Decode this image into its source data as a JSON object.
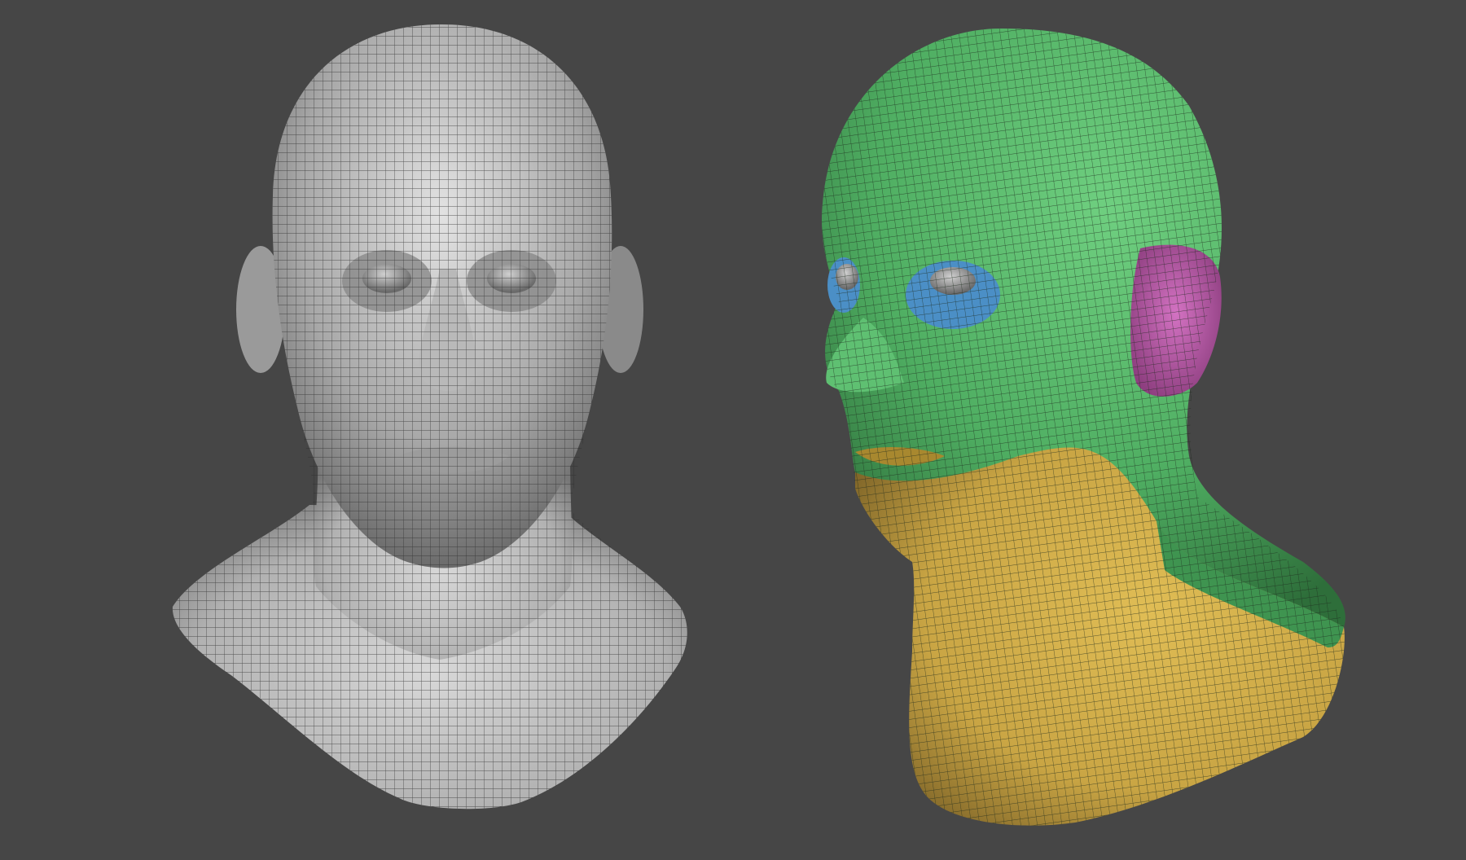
{
  "viewport": {
    "background_color": "#464646"
  },
  "models": [
    {
      "name": "front-view-head",
      "view": "front",
      "material": "clay-gray",
      "polygroups": [
        {
          "region": "head",
          "color": "#bcbcbc"
        }
      ]
    },
    {
      "name": "three-quarter-view-head",
      "view": "three-quarter",
      "material": "polygroup-colored",
      "polygroups": [
        {
          "region": "head",
          "color": "#4fae62"
        },
        {
          "region": "eye-sockets",
          "color": "#4b8fc6"
        },
        {
          "region": "ear",
          "color": "#b957a7"
        },
        {
          "region": "jaw-neck",
          "color": "#c9a544"
        },
        {
          "region": "eyeballs",
          "color": "#8e8e8e"
        }
      ]
    }
  ]
}
